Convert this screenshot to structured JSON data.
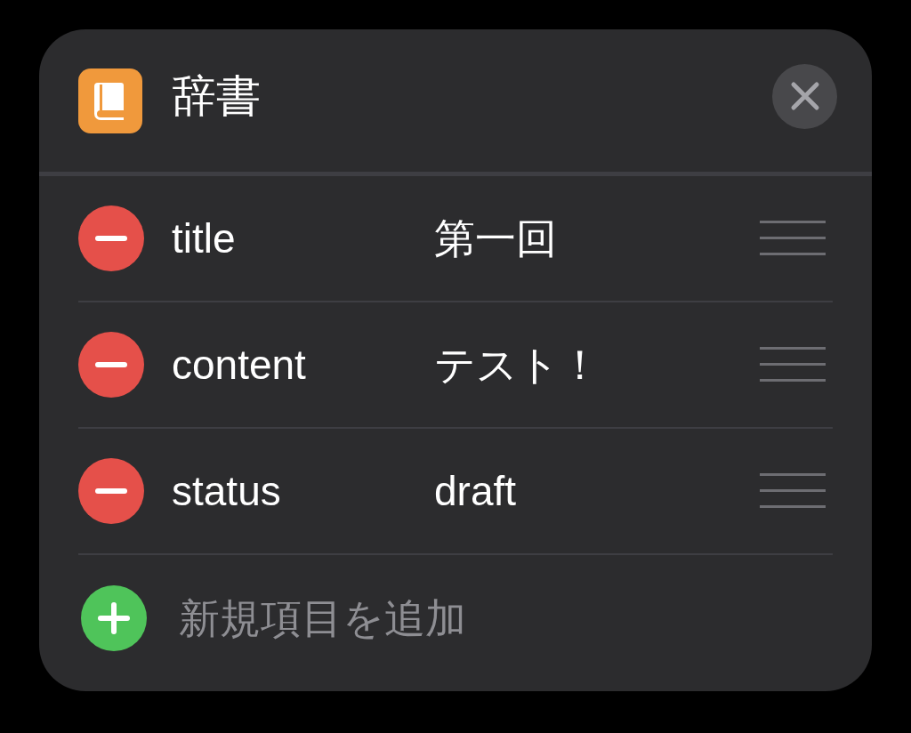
{
  "header": {
    "title": "辞書"
  },
  "entries": [
    {
      "key": "title",
      "value": "第一回"
    },
    {
      "key": "content",
      "value": "テスト！"
    },
    {
      "key": "status",
      "value": "draft"
    }
  ],
  "add_row": {
    "label": "新規項目を追加"
  }
}
